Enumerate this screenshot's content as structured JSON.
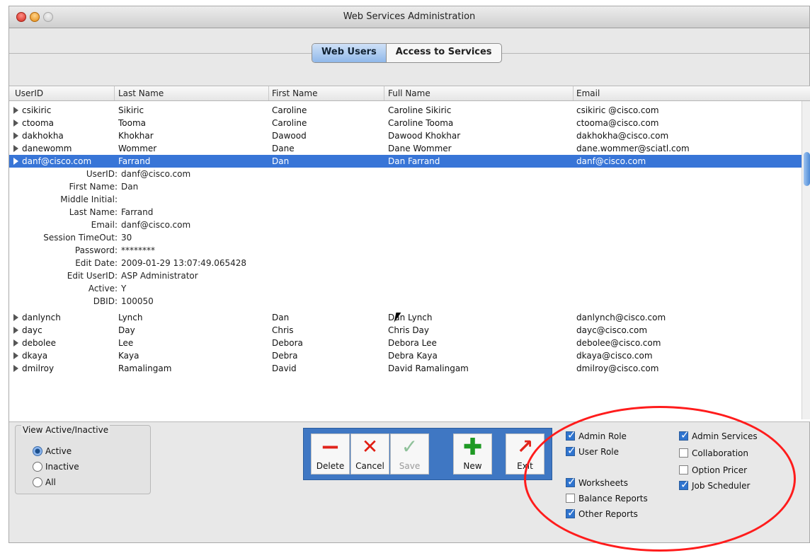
{
  "window": {
    "title": "Web Services Administration"
  },
  "tabs": [
    "Web Users",
    "Access to Services"
  ],
  "table": {
    "columns": [
      "UserID",
      "Last Name",
      "First Name",
      "Full Name",
      "Email"
    ],
    "rows": [
      [
        "csikiric",
        "Sikiric",
        "Caroline",
        "Caroline Sikiric",
        "csikiric @cisco.com"
      ],
      [
        "ctooma",
        "Tooma",
        "Caroline",
        "Caroline Tooma",
        "ctooma@cisco.com"
      ],
      [
        "dakhokha",
        "Khokhar",
        "Dawood",
        "Dawood Khokhar",
        "dakhokha@cisco.com"
      ],
      [
        "danewomm",
        "Wommer",
        "Dane",
        "Dane Wommer",
        "dane.wommer@sciatl.com"
      ]
    ],
    "selected_row": [
      "danf@cisco.com",
      "Farrand",
      "Dan",
      "Dan Farrand",
      "danf@cisco.com"
    ],
    "details": [
      {
        "label": "UserID:",
        "value": "danf@cisco.com"
      },
      {
        "label": "First Name:",
        "value": "Dan"
      },
      {
        "label": "Middle Initial:",
        "value": ""
      },
      {
        "label": "Last Name:",
        "value": "Farrand"
      },
      {
        "label": "Email:",
        "value": "danf@cisco.com"
      },
      {
        "label": "Session TimeOut:",
        "value": "30"
      },
      {
        "label": "Password:",
        "value": "********"
      },
      {
        "label": "Edit Date:",
        "value": "2009-01-29 13:07:49.065428"
      },
      {
        "label": "Edit UserID:",
        "value": "ASP Administrator"
      },
      {
        "label": "Active:",
        "value": "Y"
      },
      {
        "label": "DBID:",
        "value": "100050"
      }
    ],
    "rows_after": [
      [
        "danlynch",
        "Lynch",
        "Dan",
        "Dan Lynch",
        "danlynch@cisco.com"
      ],
      [
        "dayc",
        "Day",
        "Chris",
        "Chris Day",
        "dayc@cisco.com"
      ],
      [
        "debolee",
        "Lee",
        "Debora",
        "Debora Lee",
        "debolee@cisco.com"
      ],
      [
        "dkaya",
        "Kaya",
        "Debra",
        "Debra Kaya",
        "dkaya@cisco.com"
      ],
      [
        "dmilroy",
        "Ramalingam",
        "David",
        "David Ramalingam",
        "dmilroy@cisco.com"
      ]
    ]
  },
  "view_filter": {
    "title": "View Active/Inactive",
    "options": [
      "Active",
      "Inactive",
      "All"
    ],
    "selected": "Active"
  },
  "toolbar": {
    "buttons": [
      {
        "label": "Delete",
        "icon": "minus-icon"
      },
      {
        "label": "Cancel",
        "icon": "x-icon"
      },
      {
        "label": "Save",
        "icon": "checkmark-icon"
      },
      {
        "label": "New",
        "icon": "plus-icon"
      },
      {
        "label": "Exit",
        "icon": "exit-arrow-icon"
      }
    ]
  },
  "roles": {
    "left": [
      {
        "label": "Admin Role",
        "checked": true
      },
      {
        "label": "User Role",
        "checked": true
      },
      {
        "label": "Worksheets",
        "checked": true
      },
      {
        "label": "Balance Reports",
        "checked": false
      },
      {
        "label": "Other Reports",
        "checked": true
      }
    ],
    "right": [
      {
        "label": "Admin Services",
        "checked": true
      },
      {
        "label": "Collaboration",
        "checked": false
      },
      {
        "label": "Option Pricer",
        "checked": false
      },
      {
        "label": "Job Scheduler",
        "checked": true
      }
    ]
  },
  "colors": {
    "selection": "#3875d7",
    "annotation_circle": "#ff1c1c"
  }
}
